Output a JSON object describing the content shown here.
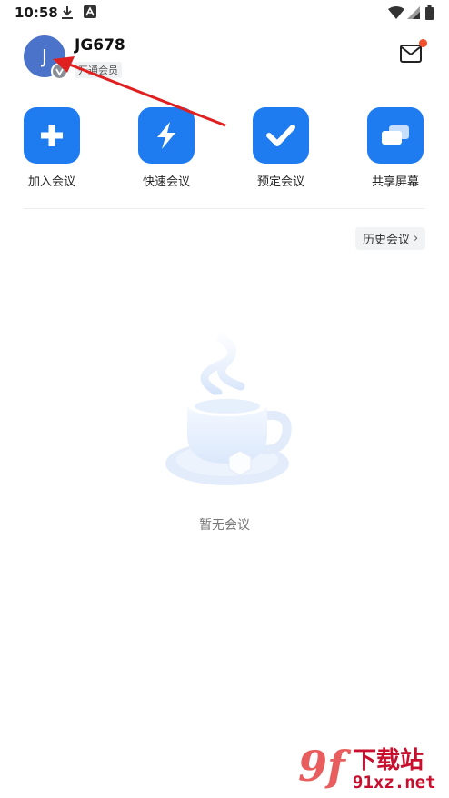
{
  "status_bar": {
    "time": "10:58",
    "icons": [
      "download-icon",
      "app-notification-icon",
      "wifi-icon",
      "signal-icon",
      "battery-icon"
    ]
  },
  "profile": {
    "avatar_letter": "J",
    "username": "JG678",
    "member_tag": "开通会员",
    "avatar_color": "#4a73c9"
  },
  "header": {
    "mail_icon": "mail-icon",
    "notification_dot_color": "#f0502a"
  },
  "actions": [
    {
      "label": "加入会议",
      "icon": "plus-icon"
    },
    {
      "label": "快速会议",
      "icon": "lightning-icon"
    },
    {
      "label": "预定会议",
      "icon": "check-icon"
    },
    {
      "label": "共享屏幕",
      "icon": "screen-share-icon"
    }
  ],
  "accent_color": "#1f7bf0",
  "history": {
    "label": "历史会议"
  },
  "empty_state": {
    "text": "暂无会议",
    "illustration": "coffee-cup-illustration"
  },
  "annotation": {
    "color": "#e02020"
  },
  "watermark": {
    "logo": "9f",
    "top_text": "下载站",
    "url_text": "91xz.net"
  }
}
